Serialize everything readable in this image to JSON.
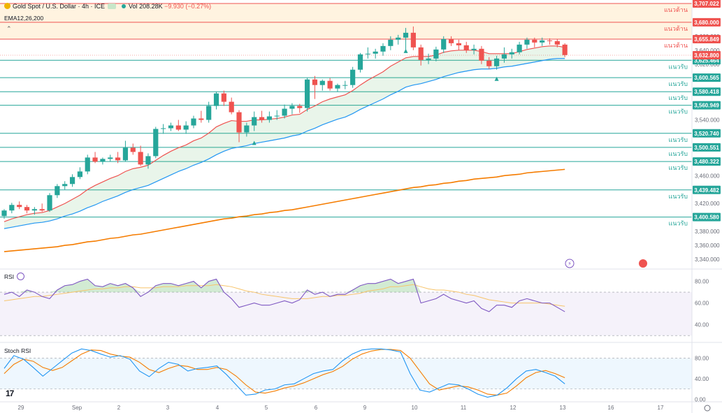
{
  "header": {
    "symbol": "Gold Spot / U.S. Dollar · 4h · ICE",
    "vol_label": "Vol",
    "vol_value": "208.28K",
    "change": "−9.930 (−0.27%)",
    "indicator": "EMA12,26,200"
  },
  "rsi_panel": {
    "label": "RSI"
  },
  "stoch_panel": {
    "label": "Stoch RSI"
  },
  "logo_text": "17",
  "colors": {
    "bull": "#26a69a",
    "bear": "#ef5350",
    "ema12": "#ef5350",
    "ema26": "#2196f3",
    "ema200": "#f57c00",
    "rsi": "#7e57c2",
    "rsi_ma": "#f7c46a",
    "stoch_k": "#2196f3",
    "stoch_d": "#f57c00",
    "resistance": "#ef5350",
    "support": "#26a69a",
    "resistance_zone": "#fff3e0"
  },
  "chart_data": {
    "type": "candlestick",
    "y_axis_ticks": [
      3660,
      3640,
      3620,
      3600,
      3580,
      3560,
      3540,
      3520,
      3500,
      3480,
      3460,
      3440,
      3420,
      3400,
      3380,
      3360,
      3340
    ],
    "ylim": [
      3327,
      3712
    ],
    "x_labels": [
      "29",
      "Sep",
      "2",
      "3",
      "4",
      "5",
      "6",
      "9",
      "10",
      "11",
      "12",
      "13",
      "16",
      "17"
    ],
    "last_price": 3632.8,
    "levels": [
      {
        "price": 3707.022,
        "label": "แนวต้าน",
        "kind": "resistance",
        "price_label": "3,707.022"
      },
      {
        "price": 3680.0,
        "label": "แนวต้าน",
        "kind": "resistance",
        "price_label": "3,680.000"
      },
      {
        "price": 3655.849,
        "label": "แนวต้าน",
        "kind": "resistance",
        "price_label": "3,655.849"
      },
      {
        "price": 3625.464,
        "label": "แนวรับ",
        "kind": "support",
        "price_label": "3,625.464"
      },
      {
        "price": 3600.565,
        "label": "แนวรับ",
        "kind": "support",
        "price_label": "3,600.565"
      },
      {
        "price": 3580.418,
        "label": "แนวรับ",
        "kind": "support",
        "price_label": "3,580.418"
      },
      {
        "price": 3560.949,
        "label": "แนวรับ",
        "kind": "support",
        "price_label": "3,560.949"
      },
      {
        "price": 3520.74,
        "label": "แนวรับ",
        "kind": "support",
        "price_label": "3,520.740"
      },
      {
        "price": 3500.551,
        "label": "แนวรับ",
        "kind": "support",
        "price_label": "3,500.551"
      },
      {
        "price": 3480.322,
        "label": "แนวรับ",
        "kind": "support",
        "price_label": "3,480.322"
      },
      {
        "price": 3439.482,
        "label": "แนวรับ",
        "kind": "support",
        "price_label": "3,439.482"
      },
      {
        "price": 3400.58,
        "label": "แนวรับ",
        "kind": "support",
        "price_label": "3,400.580"
      }
    ],
    "last_price_label": "3,632.800",
    "candles": [
      {
        "o": 3402,
        "h": 3412,
        "l": 3398,
        "c": 3410
      },
      {
        "o": 3410,
        "h": 3421,
        "l": 3406,
        "c": 3418
      },
      {
        "o": 3418,
        "h": 3423,
        "l": 3412,
        "c": 3415
      },
      {
        "o": 3415,
        "h": 3418,
        "l": 3406,
        "c": 3410
      },
      {
        "o": 3410,
        "h": 3415,
        "l": 3404,
        "c": 3412
      },
      {
        "o": 3412,
        "h": 3420,
        "l": 3408,
        "c": 3410
      },
      {
        "o": 3410,
        "h": 3435,
        "l": 3408,
        "c": 3432
      },
      {
        "o": 3432,
        "h": 3448,
        "l": 3428,
        "c": 3445
      },
      {
        "o": 3445,
        "h": 3452,
        "l": 3440,
        "c": 3448
      },
      {
        "o": 3448,
        "h": 3462,
        "l": 3444,
        "c": 3458
      },
      {
        "o": 3458,
        "h": 3472,
        "l": 3455,
        "c": 3466
      },
      {
        "o": 3466,
        "h": 3490,
        "l": 3462,
        "c": 3486
      },
      {
        "o": 3486,
        "h": 3494,
        "l": 3478,
        "c": 3480
      },
      {
        "o": 3480,
        "h": 3486,
        "l": 3476,
        "c": 3484
      },
      {
        "o": 3484,
        "h": 3490,
        "l": 3480,
        "c": 3486
      },
      {
        "o": 3486,
        "h": 3494,
        "l": 3478,
        "c": 3482
      },
      {
        "o": 3482,
        "h": 3510,
        "l": 3480,
        "c": 3500
      },
      {
        "o": 3500,
        "h": 3506,
        "l": 3490,
        "c": 3494
      },
      {
        "o": 3494,
        "h": 3503,
        "l": 3474,
        "c": 3476
      },
      {
        "o": 3476,
        "h": 3492,
        "l": 3470,
        "c": 3488
      },
      {
        "o": 3488,
        "h": 3530,
        "l": 3485,
        "c": 3527
      },
      {
        "o": 3527,
        "h": 3534,
        "l": 3520,
        "c": 3528
      },
      {
        "o": 3528,
        "h": 3536,
        "l": 3524,
        "c": 3532
      },
      {
        "o": 3532,
        "h": 3540,
        "l": 3524,
        "c": 3526
      },
      {
        "o": 3526,
        "h": 3538,
        "l": 3520,
        "c": 3532
      },
      {
        "o": 3532,
        "h": 3546,
        "l": 3528,
        "c": 3542
      },
      {
        "o": 3542,
        "h": 3553,
        "l": 3536,
        "c": 3540
      },
      {
        "o": 3540,
        "h": 3566,
        "l": 3536,
        "c": 3560
      },
      {
        "o": 3560,
        "h": 3580,
        "l": 3555,
        "c": 3578
      },
      {
        "o": 3578,
        "h": 3582,
        "l": 3560,
        "c": 3566
      },
      {
        "o": 3566,
        "h": 3572,
        "l": 3548,
        "c": 3551
      },
      {
        "o": 3551,
        "h": 3554,
        "l": 3508,
        "c": 3522
      },
      {
        "o": 3522,
        "h": 3536,
        "l": 3516,
        "c": 3532
      },
      {
        "o": 3532,
        "h": 3552,
        "l": 3524,
        "c": 3544
      },
      {
        "o": 3544,
        "h": 3553,
        "l": 3536,
        "c": 3540
      },
      {
        "o": 3540,
        "h": 3552,
        "l": 3536,
        "c": 3545
      },
      {
        "o": 3545,
        "h": 3554,
        "l": 3540,
        "c": 3546
      },
      {
        "o": 3546,
        "h": 3562,
        "l": 3542,
        "c": 3556
      },
      {
        "o": 3556,
        "h": 3564,
        "l": 3548,
        "c": 3560
      },
      {
        "o": 3560,
        "h": 3563,
        "l": 3550,
        "c": 3557
      },
      {
        "o": 3557,
        "h": 3600,
        "l": 3552,
        "c": 3598
      },
      {
        "o": 3598,
        "h": 3603,
        "l": 3570,
        "c": 3590
      },
      {
        "o": 3590,
        "h": 3598,
        "l": 3582,
        "c": 3596
      },
      {
        "o": 3596,
        "h": 3600,
        "l": 3582,
        "c": 3585
      },
      {
        "o": 3585,
        "h": 3592,
        "l": 3580,
        "c": 3590
      },
      {
        "o": 3590,
        "h": 3596,
        "l": 3584,
        "c": 3590
      },
      {
        "o": 3590,
        "h": 3616,
        "l": 3586,
        "c": 3612
      },
      {
        "o": 3612,
        "h": 3636,
        "l": 3608,
        "c": 3634
      },
      {
        "o": 3634,
        "h": 3644,
        "l": 3628,
        "c": 3635
      },
      {
        "o": 3635,
        "h": 3642,
        "l": 3628,
        "c": 3638
      },
      {
        "o": 3638,
        "h": 3650,
        "l": 3632,
        "c": 3646
      },
      {
        "o": 3646,
        "h": 3660,
        "l": 3640,
        "c": 3655
      },
      {
        "o": 3655,
        "h": 3662,
        "l": 3648,
        "c": 3658
      },
      {
        "o": 3658,
        "h": 3672,
        "l": 3640,
        "c": 3665
      },
      {
        "o": 3665,
        "h": 3674,
        "l": 3640,
        "c": 3644
      },
      {
        "o": 3644,
        "h": 3648,
        "l": 3618,
        "c": 3626
      },
      {
        "o": 3626,
        "h": 3635,
        "l": 3620,
        "c": 3628
      },
      {
        "o": 3628,
        "h": 3645,
        "l": 3624,
        "c": 3641
      },
      {
        "o": 3641,
        "h": 3660,
        "l": 3636,
        "c": 3656
      },
      {
        "o": 3656,
        "h": 3660,
        "l": 3646,
        "c": 3650
      },
      {
        "o": 3650,
        "h": 3655,
        "l": 3640,
        "c": 3647
      },
      {
        "o": 3647,
        "h": 3652,
        "l": 3636,
        "c": 3640
      },
      {
        "o": 3640,
        "h": 3648,
        "l": 3634,
        "c": 3642
      },
      {
        "o": 3642,
        "h": 3646,
        "l": 3620,
        "c": 3625
      },
      {
        "o": 3625,
        "h": 3630,
        "l": 3613,
        "c": 3617
      },
      {
        "o": 3617,
        "h": 3632,
        "l": 3612,
        "c": 3628
      },
      {
        "o": 3628,
        "h": 3644,
        "l": 3622,
        "c": 3634
      },
      {
        "o": 3634,
        "h": 3642,
        "l": 3628,
        "c": 3637
      },
      {
        "o": 3637,
        "h": 3652,
        "l": 3634,
        "c": 3648
      },
      {
        "o": 3648,
        "h": 3658,
        "l": 3642,
        "c": 3655
      },
      {
        "o": 3655,
        "h": 3658,
        "l": 3644,
        "c": 3651
      },
      {
        "o": 3651,
        "h": 3658,
        "l": 3646,
        "c": 3654
      },
      {
        "o": 3654,
        "h": 3657,
        "l": 3648,
        "c": 3653
      },
      {
        "o": 3653,
        "h": 3656,
        "l": 3644,
        "c": 3648
      },
      {
        "o": 3648,
        "h": 3650,
        "l": 3630,
        "c": 3633
      }
    ],
    "ema12": [
      3394,
      3398,
      3401,
      3404,
      3406,
      3407,
      3410,
      3415,
      3420,
      3426,
      3432,
      3440,
      3446,
      3451,
      3456,
      3460,
      3466,
      3470,
      3472,
      3475,
      3482,
      3489,
      3495,
      3500,
      3504,
      3510,
      3514,
      3521,
      3530,
      3535,
      3539,
      3538,
      3538,
      3540,
      3540,
      3541,
      3542,
      3544,
      3547,
      3548,
      3555,
      3560,
      3566,
      3570,
      3573,
      3576,
      3582,
      3590,
      3597,
      3603,
      3609,
      3617,
      3623,
      3629,
      3631,
      3631,
      3631,
      3633,
      3637,
      3639,
      3640,
      3640,
      3640,
      3638,
      3635,
      3635,
      3635,
      3635,
      3638,
      3641,
      3643,
      3645,
      3646,
      3646,
      3644
    ],
    "ema26": [
      3384,
      3386,
      3388,
      3390,
      3392,
      3393,
      3395,
      3398,
      3402,
      3405,
      3409,
      3414,
      3418,
      3423,
      3427,
      3431,
      3436,
      3440,
      3443,
      3446,
      3451,
      3456,
      3461,
      3466,
      3470,
      3475,
      3479,
      3484,
      3490,
      3495,
      3499,
      3501,
      3503,
      3506,
      3508,
      3510,
      3512,
      3514,
      3517,
      3519,
      3524,
      3528,
      3533,
      3537,
      3541,
      3544,
      3549,
      3555,
      3560,
      3565,
      3570,
      3576,
      3581,
      3587,
      3590,
      3592,
      3595,
      3598,
      3602,
      3605,
      3608,
      3610,
      3612,
      3613,
      3613,
      3614,
      3616,
      3617,
      3619,
      3621,
      3623,
      3625,
      3627,
      3628,
      3628
    ],
    "ema200": [
      3351,
      3352,
      3353,
      3354,
      3355,
      3356,
      3357,
      3358,
      3360,
      3361,
      3363,
      3365,
      3366,
      3368,
      3370,
      3371,
      3373,
      3375,
      3376,
      3378,
      3380,
      3382,
      3384,
      3386,
      3388,
      3390,
      3392,
      3394,
      3396,
      3398,
      3399,
      3401,
      3402,
      3404,
      3405,
      3407,
      3408,
      3410,
      3411,
      3413,
      3415,
      3417,
      3419,
      3421,
      3423,
      3425,
      3427,
      3429,
      3431,
      3433,
      3435,
      3437,
      3439,
      3441,
      3443,
      3444,
      3446,
      3447,
      3449,
      3450,
      3452,
      3453,
      3455,
      3456,
      3457,
      3458,
      3460,
      3461,
      3462,
      3464,
      3465,
      3466,
      3467,
      3468,
      3469
    ],
    "markers": [
      {
        "index": 33,
        "price": 3508
      },
      {
        "index": 53,
        "price": 3640
      },
      {
        "index": 65,
        "price": 3600
      }
    ],
    "rsi": {
      "ylim": [
        25,
        90
      ],
      "ticks": [
        80,
        60,
        40
      ],
      "upper": 70,
      "lower": 30,
      "values": [
        68,
        70,
        66,
        72,
        70,
        66,
        64,
        72,
        76,
        77,
        80,
        82,
        76,
        75,
        78,
        76,
        78,
        74,
        66,
        70,
        76,
        78,
        78,
        76,
        78,
        80,
        74,
        80,
        82,
        70,
        64,
        56,
        58,
        60,
        58,
        58,
        60,
        62,
        60,
        63,
        72,
        68,
        70,
        66,
        68,
        68,
        72,
        76,
        78,
        78,
        80,
        82,
        78,
        80,
        82,
        60,
        62,
        64,
        68,
        64,
        62,
        60,
        62,
        55,
        52,
        58,
        58,
        56,
        62,
        64,
        62,
        60,
        60,
        56,
        52
      ],
      "ma": [
        62,
        63,
        64,
        65,
        66,
        66,
        67,
        68,
        69,
        70,
        71,
        72,
        73,
        73,
        74,
        74,
        75,
        75,
        74,
        74,
        74,
        75,
        75,
        75,
        76,
        76,
        76,
        76,
        77,
        76,
        75,
        73,
        71,
        70,
        68,
        67,
        66,
        65,
        64,
        64,
        64,
        65,
        66,
        66,
        67,
        67,
        68,
        69,
        71,
        72,
        73,
        75,
        75,
        76,
        77,
        75,
        73,
        72,
        72,
        71,
        70,
        68,
        67,
        65,
        63,
        62,
        61,
        60,
        60,
        60,
        60,
        60,
        59,
        58,
        57
      ]
    },
    "stoch_rsi": {
      "ylim": [
        -5,
        108
      ],
      "ticks": [
        80,
        40,
        0
      ],
      "upper": 80,
      "lower": 20,
      "k": [
        60,
        85,
        78,
        62,
        45,
        60,
        75,
        90,
        98,
        95,
        88,
        82,
        85,
        78,
        55,
        44,
        60,
        72,
        68,
        55,
        60,
        62,
        65,
        48,
        28,
        8,
        10,
        18,
        20,
        28,
        30,
        40,
        50,
        55,
        58,
        75,
        88,
        96,
        98,
        98,
        96,
        92,
        50,
        18,
        14,
        22,
        30,
        28,
        20,
        10,
        4,
        8,
        22,
        40,
        55,
        58,
        52,
        45,
        30
      ],
      "d": [
        50,
        68,
        78,
        74,
        62,
        56,
        62,
        75,
        88,
        96,
        95,
        88,
        84,
        82,
        72,
        58,
        52,
        60,
        66,
        64,
        58,
        58,
        62,
        58,
        45,
        28,
        14,
        12,
        16,
        22,
        26,
        32,
        40,
        48,
        54,
        64,
        78,
        88,
        94,
        97,
        97,
        95,
        80,
        55,
        30,
        18,
        22,
        26,
        24,
        18,
        10,
        8,
        12,
        26,
        42,
        52,
        56,
        50,
        42
      ]
    }
  }
}
